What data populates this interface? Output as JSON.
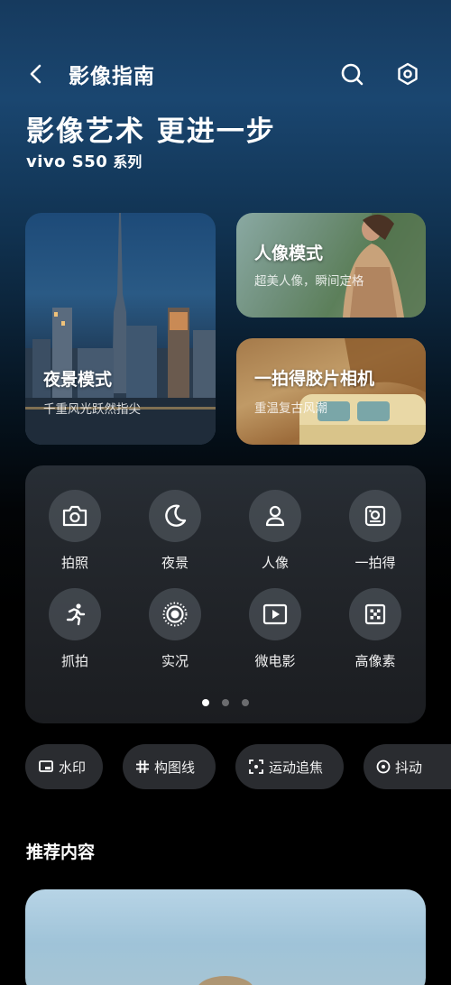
{
  "header": {
    "title": "影像指南"
  },
  "hero": {
    "title": "影像艺术 更进一步",
    "brand": "vivo S50",
    "series": "系列"
  },
  "cards": {
    "night": {
      "title": "夜景模式",
      "subtitle": "千重风光跃然指尖"
    },
    "portrait": {
      "title": "人像模式",
      "subtitle": "超美人像，瞬间定格"
    },
    "instant": {
      "title": "一拍得胶片相机",
      "subtitle": "重温复古风潮"
    }
  },
  "modes": [
    {
      "label": "拍照",
      "icon": "camera-icon"
    },
    {
      "label": "夜景",
      "icon": "moon-icon"
    },
    {
      "label": "人像",
      "icon": "person-icon"
    },
    {
      "label": "一拍得",
      "icon": "instant-camera-icon"
    },
    {
      "label": "抓拍",
      "icon": "running-icon"
    },
    {
      "label": "实况",
      "icon": "live-photo-icon"
    },
    {
      "label": "微电影",
      "icon": "play-icon"
    },
    {
      "label": "高像素",
      "icon": "dice-icon"
    }
  ],
  "pagination": {
    "count": 3,
    "active": 0
  },
  "chips": [
    {
      "label": "水印",
      "icon": "watermark-icon"
    },
    {
      "label": "构图线",
      "icon": "grid-icon"
    },
    {
      "label": "运动追焦",
      "icon": "focus-track-icon"
    },
    {
      "label": "抖动",
      "icon": "shake-icon"
    }
  ],
  "recommend": {
    "title": "推荐内容"
  }
}
